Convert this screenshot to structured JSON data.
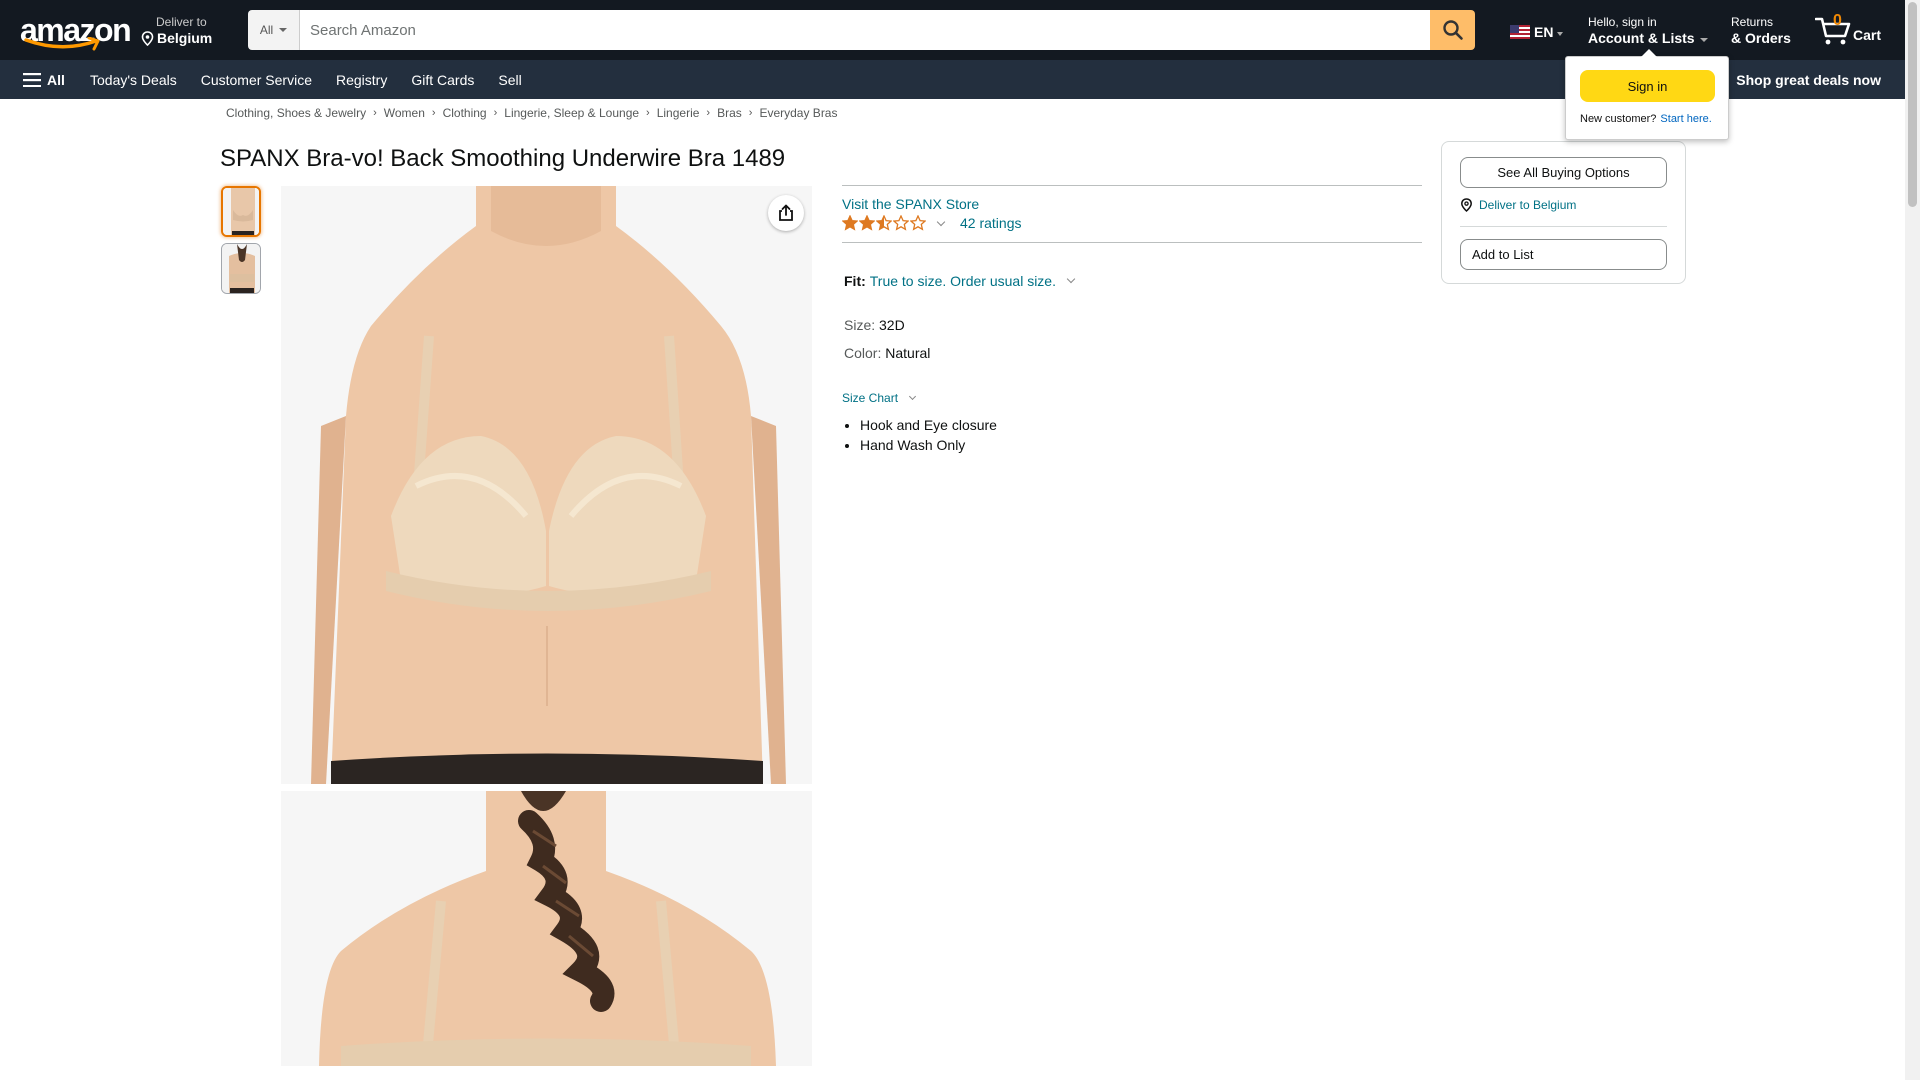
{
  "header": {
    "logo_text": "amazon",
    "deliver_line1": "Deliver to",
    "deliver_line2": "Belgium",
    "search_dept": "All",
    "search_placeholder": "Search Amazon",
    "lang": "EN",
    "account_line1": "Hello, sign in",
    "account_line2": "Account & Lists",
    "returns_line1": "Returns",
    "returns_line2": "& Orders",
    "cart_count": "0",
    "cart_label": "Cart"
  },
  "subnav": {
    "all_label": "All",
    "links": [
      "Today's Deals",
      "Customer Service",
      "Registry",
      "Gift Cards",
      "Sell"
    ],
    "promo": "Shop great deals now"
  },
  "breadcrumb": [
    "Clothing, Shoes & Jewelry",
    "Women",
    "Clothing",
    "Lingerie, Sleep & Lounge",
    "Lingerie",
    "Bras",
    "Everyday Bras"
  ],
  "product": {
    "title": "SPANX Bra-vo! Back Smoothing Underwire Bra 1489",
    "store_link": "Visit the SPANX Store",
    "rating_stars": 2.5,
    "ratings_count": "42 ratings",
    "fit_label": "Fit:",
    "fit_value": "True to size. Order usual size.",
    "size_label": "Size:",
    "size_value": "32D",
    "color_label": "Color:",
    "color_value": "Natural",
    "size_chart": "Size Chart",
    "bullets": [
      "Hook and Eye closure",
      "Hand Wash Only"
    ]
  },
  "buybox": {
    "see_all": "See All Buying Options",
    "deliver": "Deliver to Belgium",
    "add_to_list": "Add to List"
  },
  "flyout": {
    "sign_in": "Sign in",
    "new_customer": "New customer?",
    "start_here": "Start here."
  },
  "colors": {
    "nav_dark": "#131921",
    "nav_sub": "#232f3e",
    "search_button": "#febd69",
    "link": "#007185",
    "star": "#de7921",
    "sign_in_button": "#ffd814",
    "cart_count": "#f08804"
  }
}
